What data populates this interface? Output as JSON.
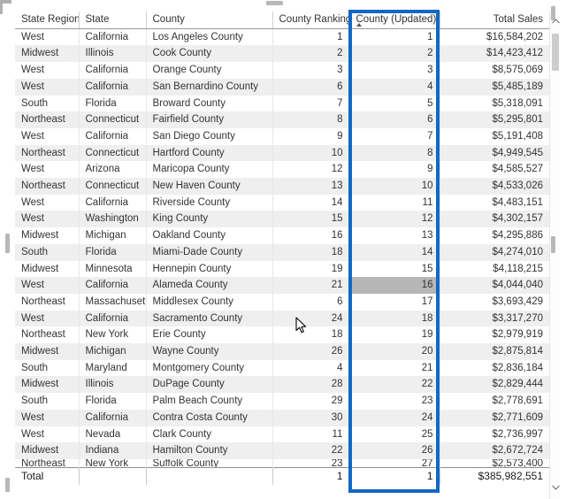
{
  "visual": {
    "type": "table-visual",
    "accent_color": "#1268c3",
    "selected_cell_color": "#b6b6b6",
    "alt_row_color": "#efefef"
  },
  "table": {
    "columns": [
      {
        "label": "State Regions",
        "align": "left",
        "sorted": false
      },
      {
        "label": "State",
        "align": "left",
        "sorted": false
      },
      {
        "label": "County",
        "align": "left",
        "sorted": false
      },
      {
        "label": "County Ranking",
        "align": "right",
        "sorted": false
      },
      {
        "label": "County (Updated)",
        "align": "right",
        "sorted": true,
        "sort_direction": "ascending"
      },
      {
        "label": "Total Sales",
        "align": "right",
        "sorted": false
      }
    ],
    "highlighted_column": "County (Updated)",
    "selected_cell": {
      "row": 16,
      "column": "County (Updated)",
      "value": "16"
    },
    "rows": [
      {
        "region": "West",
        "state": "California",
        "county": "Los Angeles County",
        "ranking": "1",
        "updated": "1",
        "sales": "$16,584,202"
      },
      {
        "region": "Midwest",
        "state": "Illinois",
        "county": "Cook County",
        "ranking": "2",
        "updated": "2",
        "sales": "$14,423,412"
      },
      {
        "region": "West",
        "state": "California",
        "county": "Orange County",
        "ranking": "3",
        "updated": "3",
        "sales": "$8,575,069"
      },
      {
        "region": "West",
        "state": "California",
        "county": "San Bernardino County",
        "ranking": "6",
        "updated": "4",
        "sales": "$5,485,189"
      },
      {
        "region": "South",
        "state": "Florida",
        "county": "Broward County",
        "ranking": "7",
        "updated": "5",
        "sales": "$5,318,091"
      },
      {
        "region": "Northeast",
        "state": "Connecticut",
        "county": "Fairfield County",
        "ranking": "8",
        "updated": "6",
        "sales": "$5,295,801"
      },
      {
        "region": "West",
        "state": "California",
        "county": "San Diego County",
        "ranking": "9",
        "updated": "7",
        "sales": "$5,191,408"
      },
      {
        "region": "Northeast",
        "state": "Connecticut",
        "county": "Hartford County",
        "ranking": "10",
        "updated": "8",
        "sales": "$4,949,545"
      },
      {
        "region": "West",
        "state": "Arizona",
        "county": "Maricopa County",
        "ranking": "12",
        "updated": "9",
        "sales": "$4,585,527"
      },
      {
        "region": "Northeast",
        "state": "Connecticut",
        "county": "New Haven County",
        "ranking": "13",
        "updated": "10",
        "sales": "$4,533,026"
      },
      {
        "region": "West",
        "state": "California",
        "county": "Riverside County",
        "ranking": "14",
        "updated": "11",
        "sales": "$4,483,151"
      },
      {
        "region": "West",
        "state": "Washington",
        "county": "King County",
        "ranking": "15",
        "updated": "12",
        "sales": "$4,302,157"
      },
      {
        "region": "Midwest",
        "state": "Michigan",
        "county": "Oakland County",
        "ranking": "16",
        "updated": "13",
        "sales": "$4,295,886"
      },
      {
        "region": "South",
        "state": "Florida",
        "county": "Miami-Dade County",
        "ranking": "18",
        "updated": "14",
        "sales": "$4,274,010"
      },
      {
        "region": "Midwest",
        "state": "Minnesota",
        "county": "Hennepin County",
        "ranking": "19",
        "updated": "15",
        "sales": "$4,118,215"
      },
      {
        "region": "West",
        "state": "California",
        "county": "Alameda County",
        "ranking": "21",
        "updated": "16",
        "sales": "$4,044,040"
      },
      {
        "region": "Northeast",
        "state": "Massachusetts",
        "county": "Middlesex County",
        "ranking": "6",
        "updated": "17",
        "sales": "$3,693,429"
      },
      {
        "region": "West",
        "state": "California",
        "county": "Sacramento County",
        "ranking": "24",
        "updated": "18",
        "sales": "$3,317,270"
      },
      {
        "region": "Northeast",
        "state": "New York",
        "county": "Erie County",
        "ranking": "18",
        "updated": "19",
        "sales": "$2,979,919"
      },
      {
        "region": "Midwest",
        "state": "Michigan",
        "county": "Wayne County",
        "ranking": "26",
        "updated": "20",
        "sales": "$2,875,814"
      },
      {
        "region": "South",
        "state": "Maryland",
        "county": "Montgomery County",
        "ranking": "4",
        "updated": "21",
        "sales": "$2,836,184"
      },
      {
        "region": "Midwest",
        "state": "Illinois",
        "county": "DuPage County",
        "ranking": "28",
        "updated": "22",
        "sales": "$2,829,444"
      },
      {
        "region": "South",
        "state": "Florida",
        "county": "Palm Beach County",
        "ranking": "29",
        "updated": "23",
        "sales": "$2,778,691"
      },
      {
        "region": "West",
        "state": "California",
        "county": "Contra Costa County",
        "ranking": "30",
        "updated": "24",
        "sales": "$2,771,609"
      },
      {
        "region": "West",
        "state": "Nevada",
        "county": "Clark County",
        "ranking": "11",
        "updated": "25",
        "sales": "$2,736,997"
      },
      {
        "region": "Midwest",
        "state": "Indiana",
        "county": "Hamilton County",
        "ranking": "22",
        "updated": "26",
        "sales": "$2,672,724"
      },
      {
        "region": "Northeast",
        "state": "New York",
        "county": "Suffolk County",
        "ranking": "23",
        "updated": "27",
        "sales": "$2,573,400"
      }
    ],
    "total_row": {
      "label": "Total",
      "state": "",
      "county": "",
      "ranking": "1",
      "updated": "1",
      "sales": "$385,982,551"
    }
  },
  "scrollbar": {
    "up_arrow": "scroll-up-icon",
    "down_arrow": "scroll-down-icon",
    "thumb": "scroll-thumb"
  },
  "icons": {
    "sort_ascending": "sort-ascending-icon",
    "cursor": "mouse-pointer-icon",
    "resize_handle": "resize-handle-icon"
  }
}
